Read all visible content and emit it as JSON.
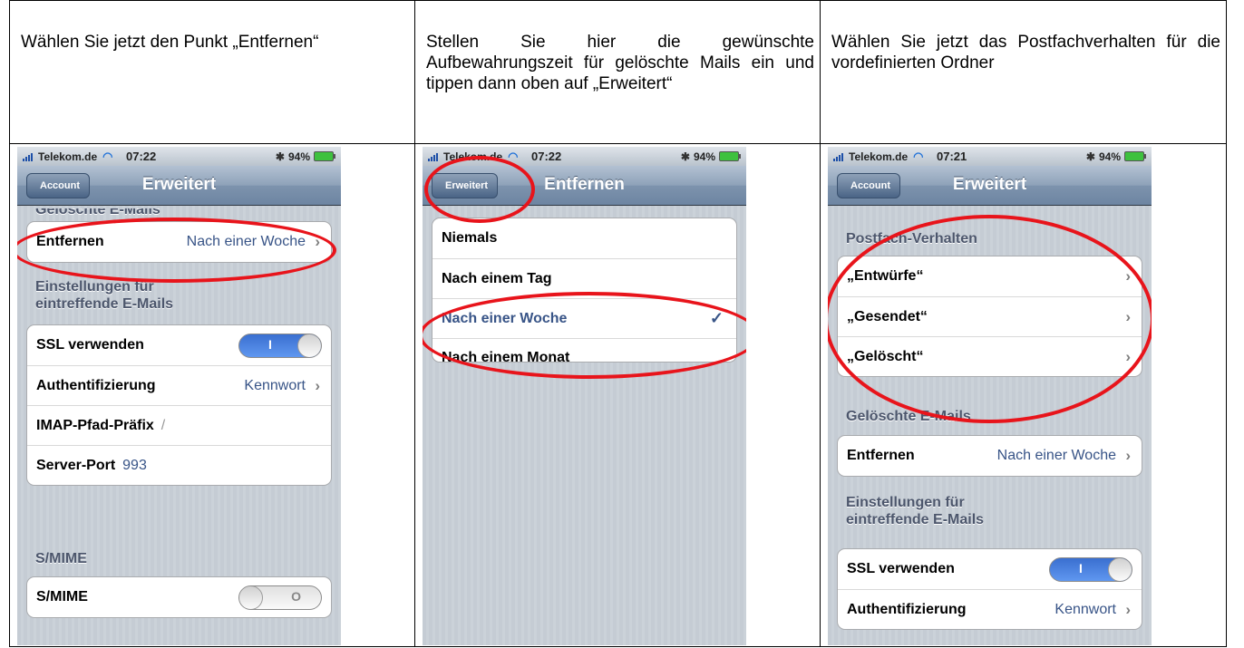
{
  "instructions": [
    "Wählen Sie jetzt den Punkt „Entfernen“",
    "Stellen Sie hier die gewünschte Aufbewahrungszeit für gelöschte Mails ein und tippen dann oben auf „Erweitert“",
    "Wählen Sie jetzt das Postfachverhalten für die vordefinierten Ordner"
  ],
  "screens": [
    {
      "status": {
        "carrier": "Telekom.de",
        "time": "07:22",
        "battery": "94%"
      },
      "nav": {
        "back": "Account",
        "title": "Erweitert"
      },
      "sections": {
        "deleted": "Gelöschte E-Mails",
        "incoming_line1": "Einstellungen für",
        "incoming_line2": "eintreffende E-Mails",
        "smime": "S/MIME"
      },
      "rows": {
        "remove_label": "Entfernen",
        "remove_value": "Nach einer Woche",
        "ssl_label": "SSL verwenden",
        "ssl_toggle": "I",
        "auth_label": "Authentifizierung",
        "auth_value": "Kennwort",
        "imap_label": "IMAP-Pfad-Präfix",
        "imap_value": "/",
        "port_label": "Server-Port",
        "port_value": "993",
        "smime_label": "S/MIME",
        "smime_toggle": "O"
      }
    },
    {
      "status": {
        "carrier": "Telekom.de",
        "time": "07:22",
        "battery": "94%"
      },
      "nav": {
        "back": "Erweitert",
        "title": "Entfernen"
      },
      "options": [
        "Niemals",
        "Nach einem Tag",
        "Nach einer Woche",
        "Nach einem Monat"
      ],
      "selected_check": "✓"
    },
    {
      "status": {
        "carrier": "Telekom.de",
        "time": "07:21",
        "battery": "94%"
      },
      "nav": {
        "back": "Account",
        "title": "Erweitert"
      },
      "sections": {
        "mailbox": "Postfach-Verhalten",
        "deleted": "Gelöschte E-Mails",
        "incoming_line1": "Einstellungen für",
        "incoming_line2": "eintreffende E-Mails"
      },
      "rows": {
        "drafts": "„Entwürfe“",
        "sent": "„Gesendet“",
        "trash": "„Gelöscht“",
        "remove_label": "Entfernen",
        "remove_value": "Nach einer Woche",
        "ssl_label": "SSL verwenden",
        "ssl_toggle": "I",
        "auth_label": "Authentifizierung",
        "auth_value": "Kennwort"
      }
    }
  ],
  "icons": {
    "chevron": "chevron-right-icon",
    "wifi": "wifi-icon",
    "bluetooth": "bluetooth-icon",
    "battery": "battery-icon"
  },
  "colors": {
    "annotation": "#e8141b",
    "link_blue": "#385487",
    "toggle_on": "#3a6fd0"
  }
}
